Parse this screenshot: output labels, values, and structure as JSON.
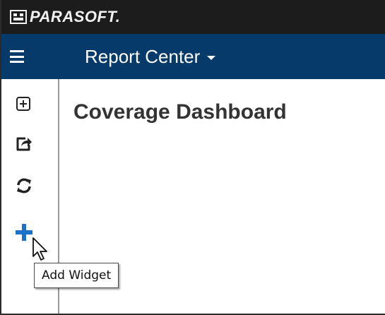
{
  "brand": {
    "logo_text": "PARASOFT.",
    "logo_icon": "parasoft-logo-icon"
  },
  "nav": {
    "menu_icon": "hamburger-menu-icon",
    "app_title": "Report Center",
    "app_title_icon": "caret-down-icon",
    "background_color": "#063a6b"
  },
  "sidebar": {
    "items": [
      {
        "icon": "expand-plus-box-icon"
      },
      {
        "icon": "share-export-icon"
      },
      {
        "icon": "refresh-icon"
      },
      {
        "icon": "add-plus-icon",
        "tooltip": "Add Widget",
        "color": "#1a73c9"
      }
    ]
  },
  "main": {
    "title": "Coverage Dashboard"
  }
}
